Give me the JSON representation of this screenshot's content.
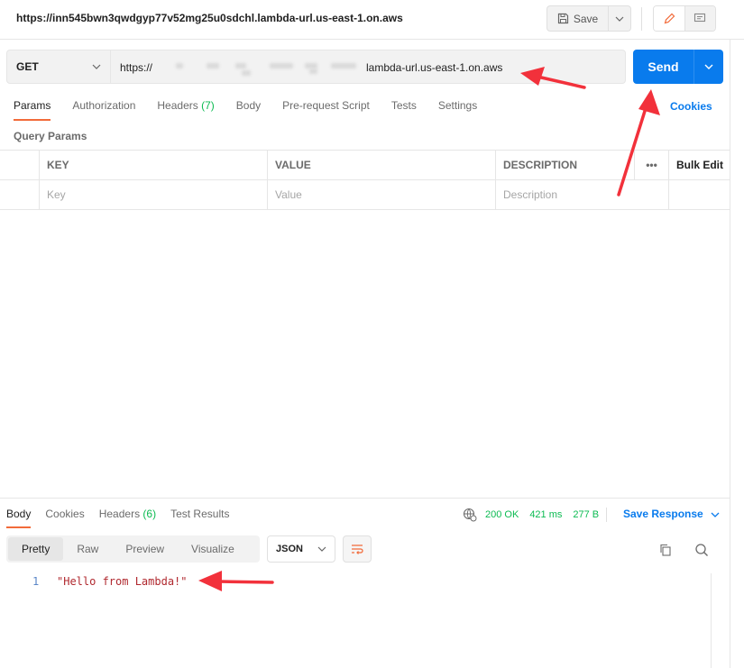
{
  "title_bar": {
    "request_name": "https://inn545bwn3qwdgyp77v52mg25u0sdchl.lambda-url.us-east-1.on.aws",
    "save_label": "Save"
  },
  "request": {
    "method": "GET",
    "url_prefix": "https://",
    "url_host": "lambda-url.us-east-1.on.aws",
    "send_label": "Send"
  },
  "request_tabs": [
    {
      "label": "Params",
      "count": ""
    },
    {
      "label": "Authorization",
      "count": ""
    },
    {
      "label": "Headers ",
      "count": "(7)"
    },
    {
      "label": "Body",
      "count": ""
    },
    {
      "label": "Pre-request Script",
      "count": ""
    },
    {
      "label": "Tests",
      "count": ""
    },
    {
      "label": "Settings",
      "count": ""
    }
  ],
  "cookies_label": "Cookies",
  "query_params": {
    "section_label": "Query Params",
    "headers": {
      "key": "KEY",
      "value": "VALUE",
      "description": "DESCRIPTION",
      "more": "•••",
      "bulk_edit": "Bulk Edit"
    },
    "placeholders": {
      "key": "Key",
      "value": "Value",
      "description": "Description"
    }
  },
  "response": {
    "tabs": [
      {
        "label": "Body",
        "count": ""
      },
      {
        "label": "Cookies",
        "count": ""
      },
      {
        "label": "Headers ",
        "count": "(6)"
      },
      {
        "label": "Test Results",
        "count": ""
      }
    ],
    "status": "200 OK",
    "time": "421 ms",
    "size": "277 B",
    "save_response_label": "Save Response",
    "view_modes": [
      "Pretty",
      "Raw",
      "Preview",
      "Visualize"
    ],
    "format": "JSON",
    "line_number": "1",
    "body": "\"Hello from Lambda!\""
  },
  "colors": {
    "accent": "#f26b3a",
    "primary": "#097bed",
    "success": "#0cbb52",
    "annotation_arrow": "#f2313b"
  }
}
